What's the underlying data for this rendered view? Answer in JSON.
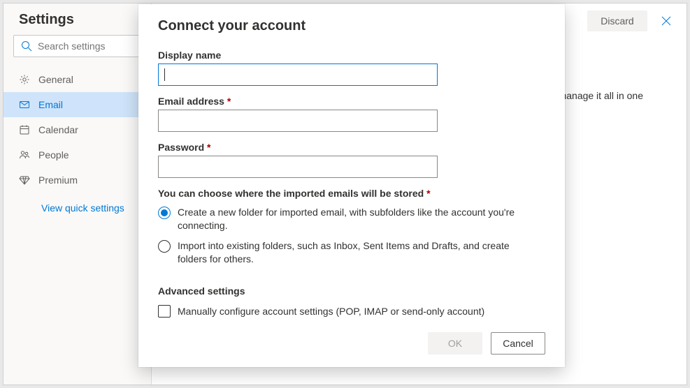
{
  "settings": {
    "title": "Settings",
    "search_placeholder": "Search settings",
    "nav": [
      {
        "label": "General"
      },
      {
        "label": "Email"
      },
      {
        "label": "Calendar"
      },
      {
        "label": "People"
      },
      {
        "label": "Premium"
      }
    ],
    "quick_link": "View quick settings"
  },
  "background": {
    "discard_label": "Discard",
    "partial_text": "manage it all in one"
  },
  "modal": {
    "title": "Connect your account",
    "fields": {
      "display_name": {
        "label": "Display name",
        "value": ""
      },
      "email": {
        "label": "Email address",
        "required": "*",
        "value": ""
      },
      "password": {
        "label": "Password",
        "required": "*",
        "value": ""
      }
    },
    "storage_note": {
      "text": "You can choose where the imported emails will be stored",
      "required": "*"
    },
    "storage_options": [
      "Create a new folder for imported email, with subfolders like the account you're connecting.",
      "Import into existing folders, such as Inbox, Sent Items and Drafts, and create folders for others."
    ],
    "advanced": {
      "title": "Advanced settings",
      "checkbox_label": "Manually configure account settings (POP, IMAP or send-only account)"
    },
    "buttons": {
      "ok": "OK",
      "cancel": "Cancel"
    }
  }
}
